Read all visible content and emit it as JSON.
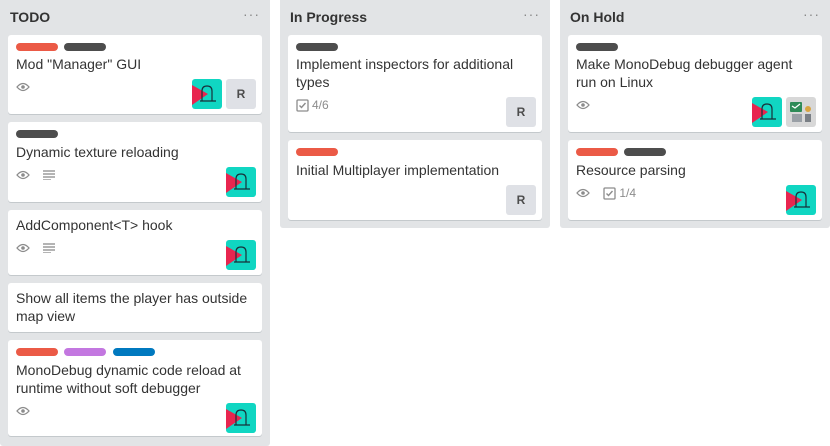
{
  "lists": [
    {
      "title": "TODO",
      "menu": "···",
      "cards": [
        {
          "title": "Mod \"Manager\" GUI",
          "labels": [
            "#eb5a46",
            "#4d4d4d"
          ],
          "badges": [
            "watch"
          ],
          "members": [
            "avatar",
            "R"
          ]
        },
        {
          "title": "Dynamic texture reloading",
          "labels": [
            "#4d4d4d"
          ],
          "badges": [
            "watch",
            "description"
          ],
          "members": [
            "avatar"
          ]
        },
        {
          "title": "AddComponent<T> hook",
          "labels": [],
          "badges": [
            "watch",
            "description"
          ],
          "members": [
            "avatar"
          ]
        },
        {
          "title": "Show all items the player has outside map view",
          "labels": [],
          "badges": [],
          "members": []
        },
        {
          "title": "MonoDebug dynamic code reload at runtime without soft debugger",
          "labels": [
            "#eb5a46",
            "#c377e0",
            "#0079bf"
          ],
          "badges": [
            "watch"
          ],
          "members": [
            "avatar"
          ]
        }
      ]
    },
    {
      "title": "In Progress",
      "menu": "···",
      "cards": [
        {
          "title": "Implement inspectors for additional types",
          "labels": [
            "#4d4d4d"
          ],
          "checklist": "4/6",
          "members": [
            "R"
          ]
        },
        {
          "title": "Initial Multiplayer implementation",
          "labels": [
            "#eb5a46"
          ],
          "members": [
            "R"
          ]
        }
      ]
    },
    {
      "title": "On Hold",
      "menu": "···",
      "cards": [
        {
          "title": "Make MonoDebug debugger agent run on Linux",
          "labels": [
            "#4d4d4d"
          ],
          "badges": [
            "watch"
          ],
          "members": [
            "avatar",
            "avatar2"
          ]
        },
        {
          "title": "Resource parsing",
          "labels": [
            "#eb5a46",
            "#4d4d4d"
          ],
          "badges": [
            "watch"
          ],
          "checklist": "1/4",
          "members": [
            "avatar"
          ]
        }
      ]
    }
  ],
  "member_initial": "R",
  "colors": {
    "list_bg": "#e2e4e6",
    "red": "#eb5a46",
    "dark": "#4d4d4d",
    "purple": "#c377e0",
    "blue": "#0079bf",
    "teal": "#10d6c2",
    "pink": "#e8254f"
  }
}
